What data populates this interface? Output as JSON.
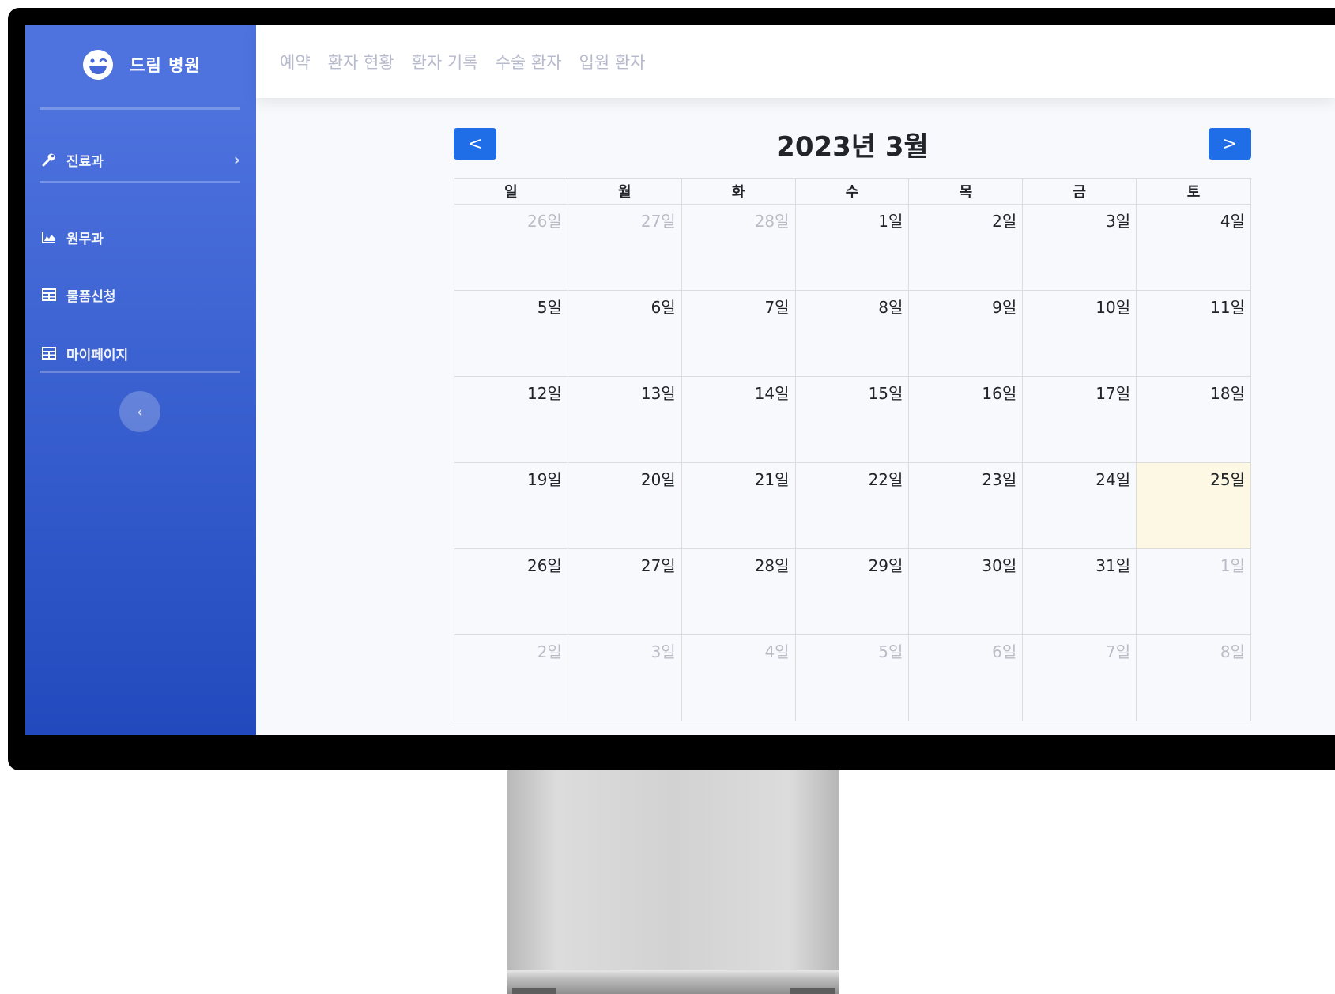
{
  "sidebar": {
    "brand": "드림 병원",
    "items": [
      {
        "label": "진료과"
      },
      {
        "label": "원무과"
      },
      {
        "label": "물품신청"
      },
      {
        "label": "마이페이지"
      }
    ],
    "toggle_icon": "chevron-left-icon"
  },
  "topbar": {
    "links": [
      {
        "label": "예약"
      },
      {
        "label": "환자 현황"
      },
      {
        "label": "환자 기록"
      },
      {
        "label": "수술 환자"
      },
      {
        "label": "입원 환자"
      }
    ]
  },
  "calendar": {
    "title": "2023년 3월",
    "prev_label": "<",
    "next_label": ">",
    "weekdays": [
      "일",
      "월",
      "화",
      "수",
      "목",
      "금",
      "토"
    ],
    "weeks": [
      [
        {
          "label": "26일",
          "other": true
        },
        {
          "label": "27일",
          "other": true
        },
        {
          "label": "28일",
          "other": true
        },
        {
          "label": "1일"
        },
        {
          "label": "2일"
        },
        {
          "label": "3일"
        },
        {
          "label": "4일"
        }
      ],
      [
        {
          "label": "5일"
        },
        {
          "label": "6일"
        },
        {
          "label": "7일"
        },
        {
          "label": "8일"
        },
        {
          "label": "9일"
        },
        {
          "label": "10일"
        },
        {
          "label": "11일"
        }
      ],
      [
        {
          "label": "12일"
        },
        {
          "label": "13일"
        },
        {
          "label": "14일"
        },
        {
          "label": "15일"
        },
        {
          "label": "16일"
        },
        {
          "label": "17일"
        },
        {
          "label": "18일"
        }
      ],
      [
        {
          "label": "19일"
        },
        {
          "label": "20일"
        },
        {
          "label": "21일"
        },
        {
          "label": "22일"
        },
        {
          "label": "23일"
        },
        {
          "label": "24일"
        },
        {
          "label": "25일",
          "today": true
        }
      ],
      [
        {
          "label": "26일"
        },
        {
          "label": "27일"
        },
        {
          "label": "28일"
        },
        {
          "label": "29일"
        },
        {
          "label": "30일"
        },
        {
          "label": "31일"
        },
        {
          "label": "1일",
          "other": true
        }
      ],
      [
        {
          "label": "2일",
          "other": true
        },
        {
          "label": "3일",
          "other": true
        },
        {
          "label": "4일",
          "other": true
        },
        {
          "label": "5일",
          "other": true
        },
        {
          "label": "6일",
          "other": true
        },
        {
          "label": "7일",
          "other": true
        },
        {
          "label": "8일",
          "other": true
        }
      ]
    ]
  },
  "colors": {
    "sidebar_top": "#4e73df",
    "sidebar_bottom": "#224abe",
    "nav_button": "#1f6ee8",
    "today_highlight": "#fcf8e3"
  }
}
